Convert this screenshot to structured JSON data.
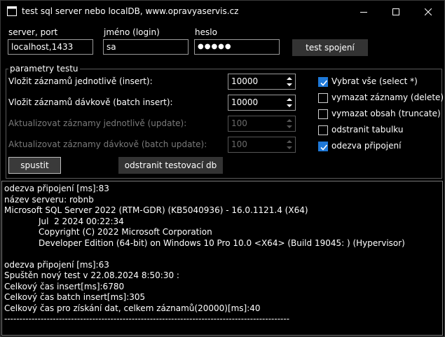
{
  "window": {
    "title": "test sql server nebo localDB, www.opravyaservis.cz"
  },
  "connection": {
    "server_label": "server, port",
    "server_value": "localhost,1433",
    "login_label": "jméno (login)",
    "login_value": "sa",
    "password_label": "heslo",
    "password_value": "●●●●●",
    "test_button": "test spojení"
  },
  "params": {
    "group_title": "parametry testu",
    "insert_label": "Vložit záznamů jednotlivě (insert):",
    "insert_value": "10000",
    "batch_insert_label": "Vložit záznamů dávkově (batch insert):",
    "batch_insert_value": "10000",
    "update_label": "Aktualizovat záznamy jednotlivě (update):",
    "update_value": "100",
    "batch_update_label": "Aktualizovat záznamy dávkově (batch update):",
    "batch_update_value": "100",
    "checkboxes": [
      {
        "label": "Vybrat vše (select *)",
        "checked": true
      },
      {
        "label": "vymazat záznamy (delete)",
        "checked": false
      },
      {
        "label": "vymazat obsah (truncate)",
        "checked": false
      },
      {
        "label": "odstranit tabulku",
        "checked": false
      },
      {
        "label": "odezva připojení",
        "checked": true
      }
    ],
    "run_button": "spustit",
    "drop_db_button": "odstranit testovací db"
  },
  "output": {
    "lines": [
      "odezva připojení [ms]:83",
      "název serveru: robnb",
      "Microsoft SQL Server 2022 (RTM-GDR) (KB5040936) - 16.0.1121.4 (X64)",
      "Jul  2 2024 00:22:34",
      "Copyright (C) 2022 Microsoft Corporation",
      "Developer Edition (64-bit) on Windows 10 Pro 10.0 <X64> (Build 19045: ) (Hypervisor)",
      "",
      "odezva připojení [ms]:63",
      "Spuštěn nový test v 22.08.2024 8:50:30 :",
      "Celkový čas insert[ms]:6780",
      "Celkový čas batch insert[ms]:305",
      "Celkový čas pro získání dat, celkem záznamů(20000)[ms]:40",
      "----------------------------------------------------------------------------------------------"
    ]
  }
}
